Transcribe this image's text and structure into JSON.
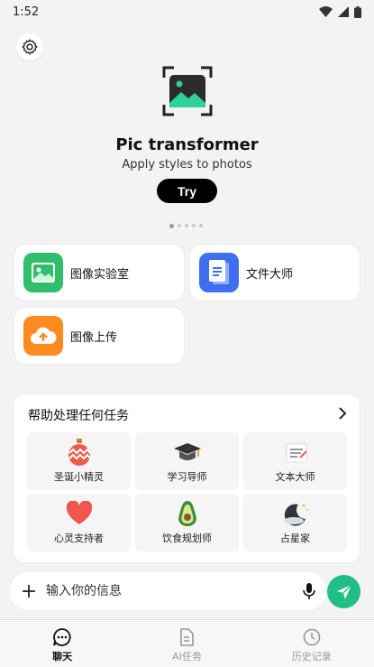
{
  "status_bar": {
    "time": "1:52"
  },
  "hero": {
    "title": "Pic transformer",
    "subtitle": "Apply styles to photos",
    "try_label": "Try",
    "carousel_pages": 5,
    "carousel_active_index": 0
  },
  "tools": [
    {
      "label": "图像实验室",
      "icon": "image-lab-icon",
      "color": "#2fbf6a"
    },
    {
      "label": "文件大师",
      "icon": "document-icon",
      "color": "#3d6fef"
    },
    {
      "label": "图像上传",
      "icon": "cloud-upload-icon",
      "color": "#ff8a1f"
    }
  ],
  "tasks": {
    "title": "帮助处理任何任务",
    "items": [
      {
        "label": "圣诞小精灵",
        "icon": "christmas-ornament-icon"
      },
      {
        "label": "学习导师",
        "icon": "graduation-cap-icon"
      },
      {
        "label": "文本大师",
        "icon": "text-note-icon"
      },
      {
        "label": "心灵支持者",
        "icon": "heart-icon"
      },
      {
        "label": "饮食规划师",
        "icon": "avocado-icon"
      },
      {
        "label": "占星家",
        "icon": "moon-stars-icon"
      }
    ]
  },
  "input": {
    "placeholder": "输入你的信息"
  },
  "nav": {
    "items": [
      {
        "label": "聊天",
        "icon": "chat-icon",
        "active": true
      },
      {
        "label": "AI任务",
        "icon": "task-doc-icon",
        "active": false
      },
      {
        "label": "历史记录",
        "icon": "clock-icon",
        "active": false
      }
    ]
  },
  "colors": {
    "accent": "#1fbf86"
  }
}
